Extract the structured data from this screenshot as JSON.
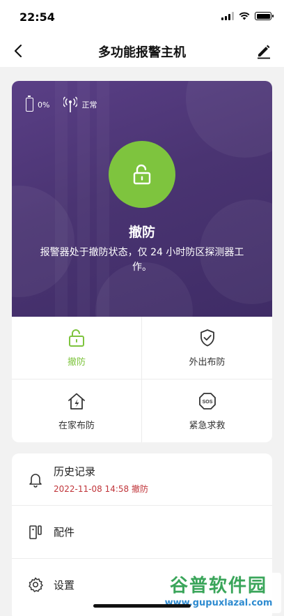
{
  "status_bar": {
    "time": "22:54"
  },
  "nav": {
    "title": "多功能报警主机"
  },
  "hero": {
    "battery_level": "0%",
    "signal_status": "正常",
    "mode_title": "撤防",
    "mode_description": "报警器处于撤防状态，仅 24 小时防区探测器工作。"
  },
  "modes": [
    {
      "label": "撤防",
      "icon": "unlock-icon",
      "active": true
    },
    {
      "label": "外出布防",
      "icon": "shield-check-icon",
      "active": false
    },
    {
      "label": "在家布防",
      "icon": "home-bolt-icon",
      "active": false
    },
    {
      "label": "紧急求救",
      "icon": "sos-icon",
      "active": false
    }
  ],
  "list": {
    "history": {
      "title": "历史记录",
      "subtitle": "2022-11-08 14:58 撤防"
    },
    "parts": {
      "title": "配件"
    },
    "settings": {
      "title": "设置"
    }
  },
  "watermark": {
    "main": "谷普软件园",
    "sub": "www.gupuxlazal.com"
  },
  "colors": {
    "accent_green": "#7ec43e",
    "hero_purple": "#4a3472",
    "history_red": "#c0353a"
  }
}
